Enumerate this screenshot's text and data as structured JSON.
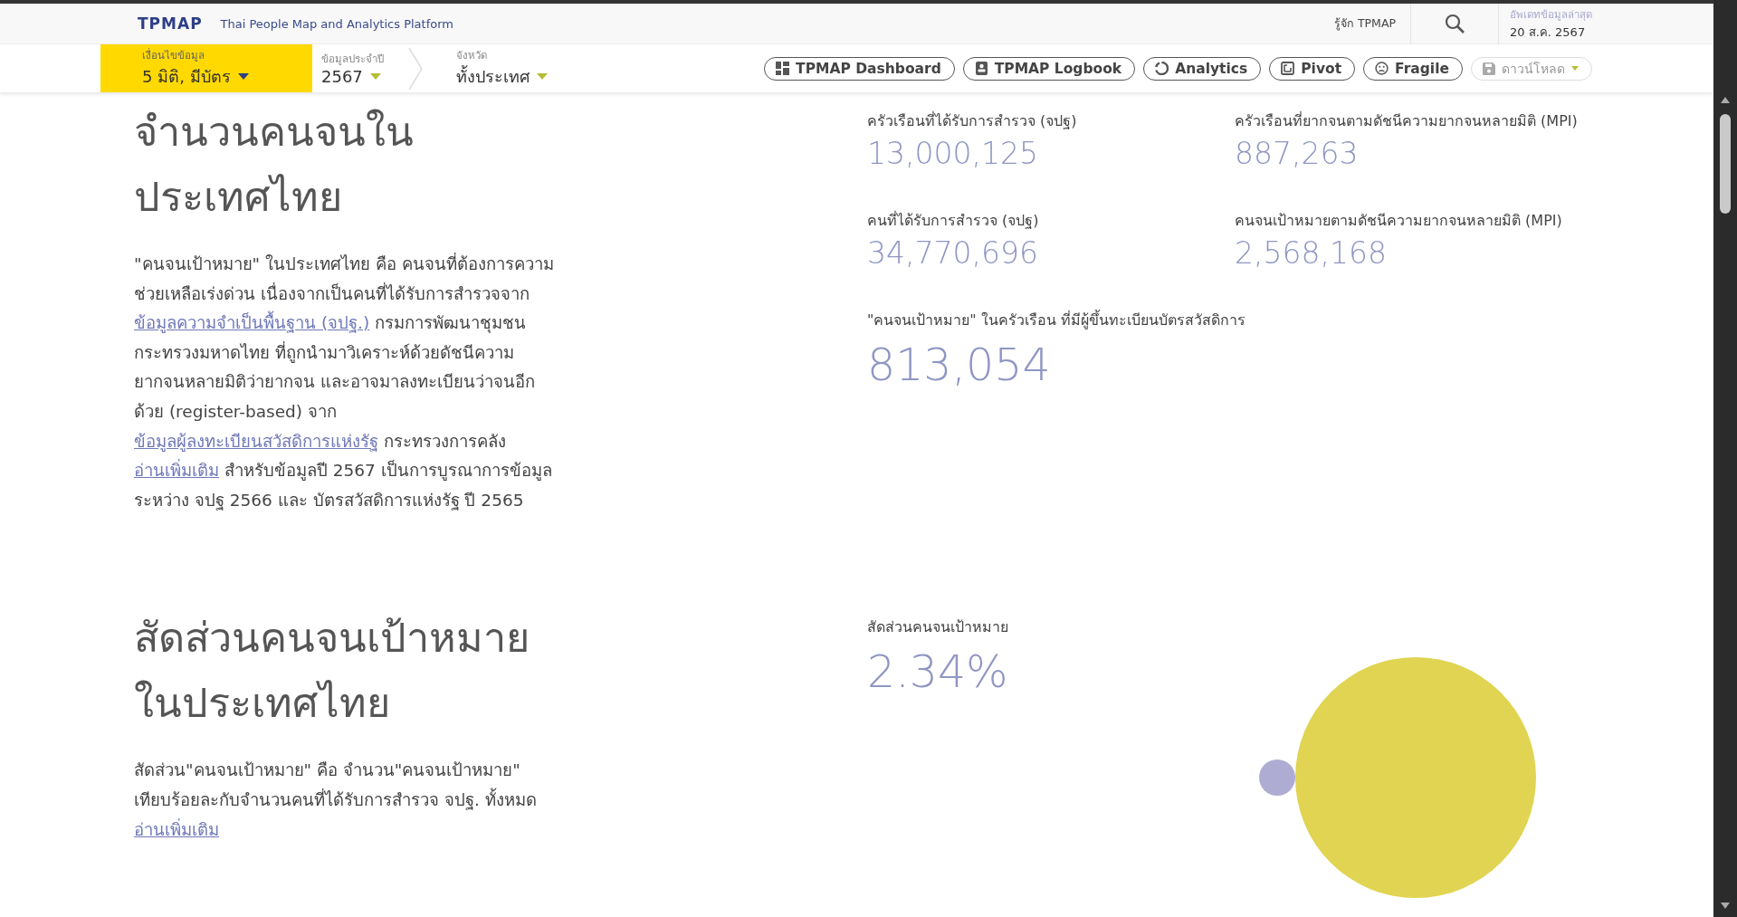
{
  "header": {
    "logo": "TPMAP",
    "subtitle": "Thai People Map and Analytics Platform",
    "about_link": "รู้จัก TPMAP",
    "update_label": "อัพเดทข้อมูลล่าสุด",
    "update_date": "20 ส.ค. 2567"
  },
  "filters": [
    {
      "label": "เงื่อนไขข้อมูล",
      "value": "5 มิติ, มีบัตร",
      "selected": true
    },
    {
      "label": "ข้อมูลประจำปี",
      "value": "2567",
      "selected": false
    },
    {
      "label": "จังหวัด",
      "value": "ทั้งประเทศ",
      "selected": false
    }
  ],
  "toolbar": [
    {
      "kind": "dashboard",
      "label": "TPMAP Dashboard",
      "disabled": false
    },
    {
      "kind": "logbook",
      "label": "TPMAP Logbook",
      "disabled": false
    },
    {
      "kind": "analytics",
      "label": "Analytics",
      "disabled": false
    },
    {
      "kind": "pivot",
      "label": "Pivot",
      "disabled": false
    },
    {
      "kind": "fragile",
      "label": "Fragile",
      "disabled": false
    },
    {
      "kind": "download",
      "label": "ดาวน์โหลด",
      "disabled": true
    }
  ],
  "sections": [
    {
      "title": "จำนวนคนจนในประเทศไทย",
      "description": [
        {
          "text": "\"คนจนเป้าหมาย\" ในประเทศไทย คือ คนจนที่ต้องการความช่วยเหลือเร่งด่วน เนื่องจากเป็นคนที่ได้รับการสำรวจจาก ",
          "link": false
        },
        {
          "text": "ข้อมูลความจำเป็นพื้นฐาน (จปฐ.)",
          "link": true
        },
        {
          "text": " กรมการพัฒนาชุมชน กระทรวงมหาดไทย ที่ถูกนำมาวิเคราะห์ด้วยดัชนีความยากจนหลายมิติว่ายากจน และอาจมาลงทะเบียนว่าจนอีกด้วย (register-based) จาก ",
          "link": false
        },
        {
          "text": "ข้อมูลผู้ลงทะเบียนสวัสดิการแห่งรัฐ",
          "link": true
        },
        {
          "text": " กระทรวงการคลัง ",
          "link": false
        },
        {
          "text": "อ่านเพิ่มเติม",
          "link": true
        },
        {
          "text": " สำหรับข้อมูลปี 2567 เป็นการบูรณาการข้อมูลระหว่าง จปฐ 2566 และ บัตรสวัสดิการแห่งรัฐ ปี 2565",
          "link": false
        }
      ],
      "stats": [
        {
          "kind": "normal",
          "label": "ครัวเรือนที่ได้รับการสำรวจ (จปฐ)",
          "value": "13,000,125"
        },
        {
          "kind": "normal",
          "label": "ครัวเรือนที่ยากจนตามดัชนีความยากจนหลายมิติ (MPI)",
          "value": "887,263"
        },
        {
          "kind": "normal",
          "label": "คนที่ได้รับการสำรวจ (จปฐ)",
          "value": "34,770,696"
        },
        {
          "kind": "normal",
          "label": "คนจนเป้าหมายตามดัชนีความยากจนหลายมิติ (MPI)",
          "value": "2,568,168"
        },
        {
          "kind": "large",
          "label": "\"คนจนเป้าหมาย\" ในครัวเรือน ที่มีผู้ขึ้นทะเบียนบัตรสวัสดิการ",
          "value": "813,054"
        }
      ]
    },
    {
      "title": "สัดส่วนคนจนเป้าหมายในประเทศไทย",
      "description": [
        {
          "text": "สัดส่วน\"คนจนเป้าหมาย\" คือ จำนวน\"คนจนเป้าหมาย\" เทียบร้อยละกับจำนวนคนที่ได้รับการสำรวจ จปฐ. ทั้งหมด ",
          "link": false
        },
        {
          "text": "อ่านเพิ่มเติม",
          "link": true
        }
      ],
      "stats": [
        {
          "kind": "large",
          "label": "สัดส่วนคนจนเป้าหมาย",
          "value": "2.34%"
        }
      ],
      "bubbles": [
        {
          "color": "#afacd4"
        },
        {
          "color": "#e0d452"
        }
      ]
    }
  ]
}
